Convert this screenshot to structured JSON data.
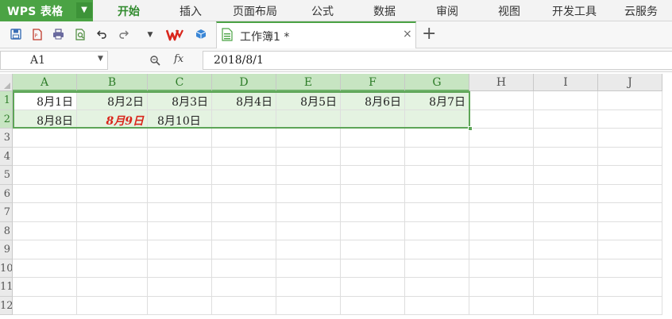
{
  "app": {
    "logo": "WPS 表格"
  },
  "menu": [
    "开始",
    "插入",
    "页面布局",
    "公式",
    "数据",
    "审阅",
    "视图",
    "开发工具",
    "云服务"
  ],
  "toolbar": {
    "icons": [
      "save-icon",
      "export-pdf-icon",
      "print-icon",
      "print-preview-icon",
      "undo-icon",
      "redo-icon",
      "dropdown-icon",
      "wps-docer-icon",
      "cloud-box-icon"
    ],
    "document_tab": "工作簿1 *",
    "close_glyph": "×",
    "new_tab_glyph": "+"
  },
  "formula_bar": {
    "cell_ref": "A1",
    "fx": "fx",
    "value": "2018/8/1"
  },
  "grid": {
    "columns": [
      "A",
      "B",
      "C",
      "D",
      "E",
      "F",
      "G",
      "H",
      "I",
      "J"
    ],
    "selected_columns": [
      "A",
      "B",
      "C",
      "D",
      "E",
      "F",
      "G"
    ],
    "row_numbers": [
      "1",
      "2",
      "3",
      "4",
      "5",
      "6",
      "7",
      "8",
      "9",
      "10",
      "11",
      "12"
    ],
    "rows": [
      [
        "8月1日",
        "8月2日",
        "8月3日",
        "8月4日",
        "8月5日",
        "8月6日",
        "8月7日"
      ],
      [
        "8月8日",
        "8月9日",
        "8月10日",
        "",
        "",
        "",
        ""
      ]
    ],
    "highlight_cell": "B2",
    "highlight_color": "#d9261c",
    "accent_color": "#4ba344"
  }
}
